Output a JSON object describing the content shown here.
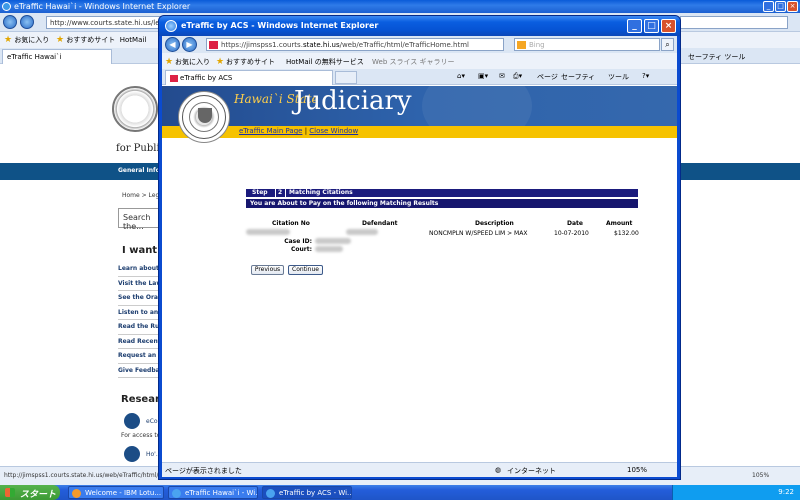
{
  "bg": {
    "title": "eTraffic Hawai`i - Windows Internet Explorer",
    "url": "http://www.courts.state.hi.us/leg...",
    "fav_label": "お気に入り",
    "fav_item1": "おすすめサイト",
    "fav_item2": "HotMail",
    "tab_label": "eTraffic Hawai`i",
    "tools_right": "セーフティ  ツール",
    "for_public": "for Public",
    "nav_label": "General Inform...",
    "breadcrumb": "Home  >  Leg...",
    "search_text": "Search the...",
    "i_want": "I want to",
    "links": [
      "Learn about t...",
      "Visit the Law...",
      "See the Oral...",
      "Listen to an O...",
      "Read the Rule...",
      "Read Recent...",
      "Request an A...",
      "Give Feedba..."
    ],
    "research": "Researc",
    "access_text": "For access to...",
    "ecourt_label": "eCo...",
    "howto_label": "Ho'...",
    "status_url": "http://jimspss1.courts.state.hi.us/web/eTraffic/html/e...",
    "zoom": "105%"
  },
  "fg": {
    "title": "eTraffic by ACS - Windows Internet Explorer",
    "url_pre": "https://jimspss1.courts.",
    "url_host": "state.hi.us",
    "url_post": "/web/eTraffic/html/eTrafficHome.html",
    "search_placeholder": "Bing",
    "fav_label": "お気に入り",
    "fav_item1": "おすすめサイト",
    "fav_item2": "HotMail の無料サービス",
    "fav_item3": "Web スライス ギャラリー",
    "tab_label": "eTraffic by ACS",
    "tool_page": "ページ",
    "tool_safety": "セーフティ",
    "tool_tools": "ツール",
    "status_text": "ページが表示されました",
    "status_zone": "インターネット",
    "status_zoom": "105%"
  },
  "page": {
    "banner_state": "Hawai`i State",
    "banner_title": "Judiciary",
    "link_main": "eTraffic Main Page",
    "link_sep": "|",
    "link_close": "Close Window",
    "step_label": "Step",
    "step_num": "2",
    "step_title": "Matching Citations",
    "info": "You are About to Pay on the following Matching Results",
    "headers": {
      "citation": "Citation No",
      "defendant": "Defendant",
      "description": "Description",
      "date": "Date",
      "amount": "Amount"
    },
    "row": {
      "description": "NONCMPLN W/SPEED LIM > MAX",
      "date": "10-07-2010",
      "amount": "$132.00",
      "case_label": "Case ID:",
      "court_label": "Court:"
    },
    "btn_prev": "Previous",
    "btn_next": "Continue"
  },
  "taskbar": {
    "start": "スタート",
    "tasks": [
      "Welcome - IBM Lotu...",
      "eTraffic Hawai`i - Wi...",
      "eTraffic by ACS - Wi..."
    ],
    "clock": "9:22"
  }
}
